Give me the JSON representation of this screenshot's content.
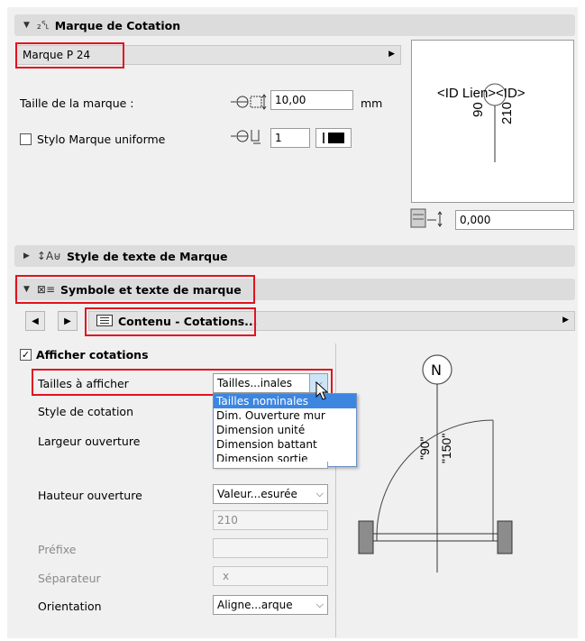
{
  "section1": {
    "title": "Marque de Cotation",
    "marker_select": "Marque P 24",
    "marker_size_label": "Taille de la marque :",
    "marker_size_value": "10,00",
    "marker_size_unit": "mm",
    "uniform_pen_label": "Stylo Marque uniforme",
    "uniform_pen_checked": false,
    "pen_value": "1",
    "offset_value": "0,000"
  },
  "preview_top": {
    "id_label": "<ID Lien><ID>",
    "width_text": "90",
    "height_text": "210"
  },
  "section2": {
    "title": "Style de texte de Marque"
  },
  "section3": {
    "title": "Symbole et texte de marque",
    "page_select": "Contenu - Cotations...",
    "show_dims_label": "Afficher cotations",
    "show_dims_checked": true,
    "rows": {
      "sizes_label": "Tailles à afficher",
      "sizes_value": "Tailles...inales",
      "dim_style_label": "Style de cotation",
      "width_label": "Largeur ouverture",
      "height_label": "Hauteur ouverture",
      "height_value": "Valeur...esurée",
      "height_number": "210",
      "prefix_label": "Préfixe",
      "separator_label": "Séparateur",
      "separator_value": "x",
      "orientation_label": "Orientation",
      "orientation_value": "Aligne...arque"
    },
    "dropdown_options": [
      "Tailles nominales",
      "Dim. Ouverture mur",
      "Dimension unité",
      "Dimension battant",
      "Dimension sortie"
    ],
    "dropdown_selected_index": 0
  },
  "preview_bottom": {
    "north_label": "N",
    "width_text": "\"90\"",
    "height_text": "\"150\""
  },
  "colors": {
    "highlight": "#e0131f",
    "selection": "#3d86e0",
    "header": "#dcdcdc",
    "panel": "#f0f0f0"
  }
}
